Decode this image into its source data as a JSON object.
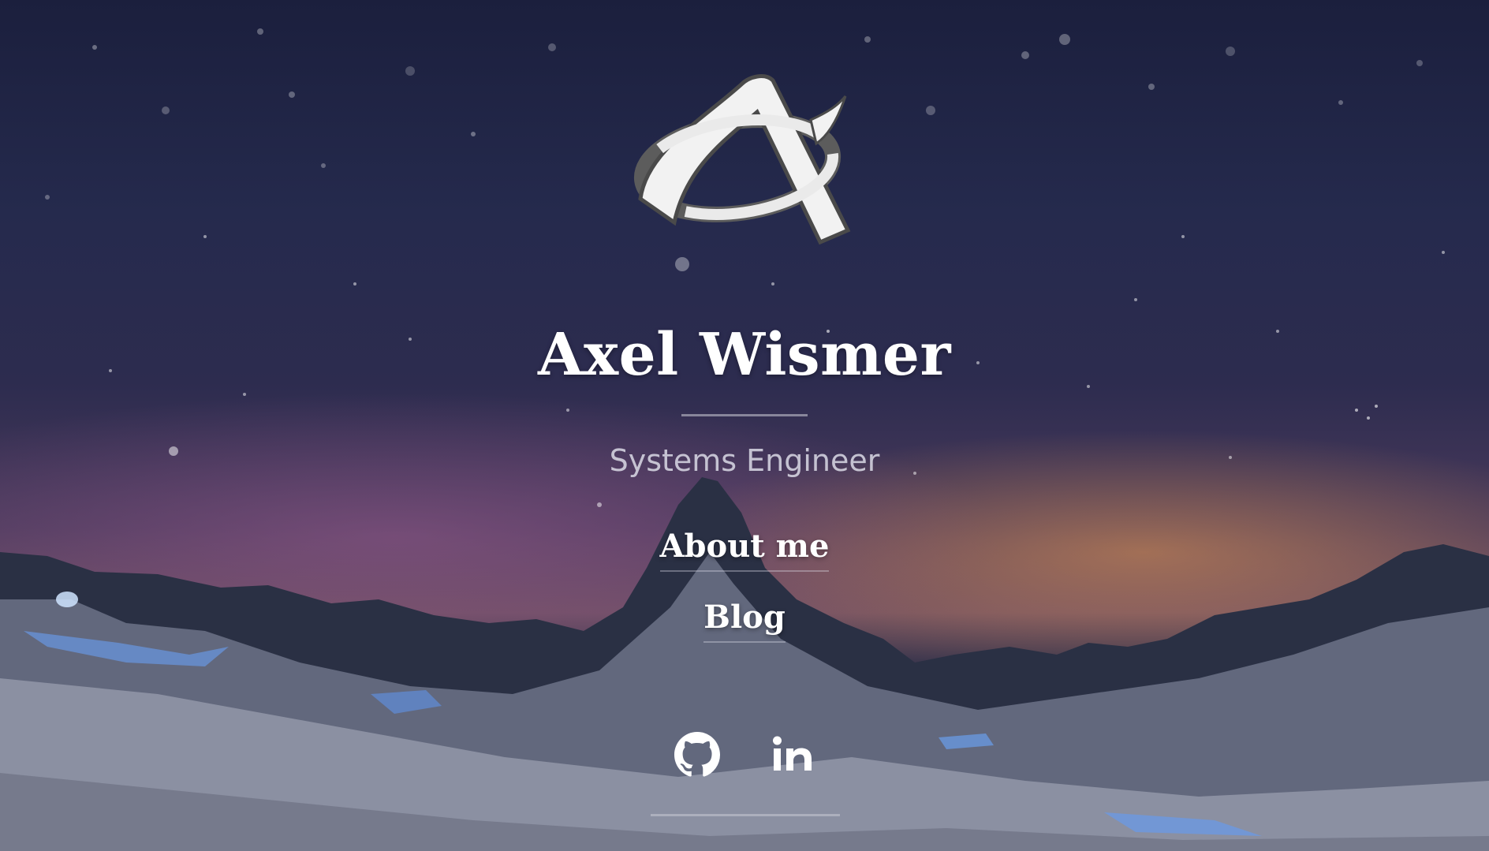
{
  "profile": {
    "name": "Axel Wismer",
    "title": "Systems Engineer"
  },
  "nav": {
    "items": [
      {
        "label": "About me"
      },
      {
        "label": "Blog"
      }
    ]
  },
  "social": {
    "github": {
      "icon": "github-icon"
    },
    "linkedin": {
      "icon": "linkedin-icon",
      "label": "in"
    }
  },
  "logo": {
    "icon": "axel-a-logo"
  },
  "colors": {
    "text": "#ffffff",
    "subtitle": "#dedee8",
    "sky": "#252a4d",
    "horizon": "#e29650"
  }
}
